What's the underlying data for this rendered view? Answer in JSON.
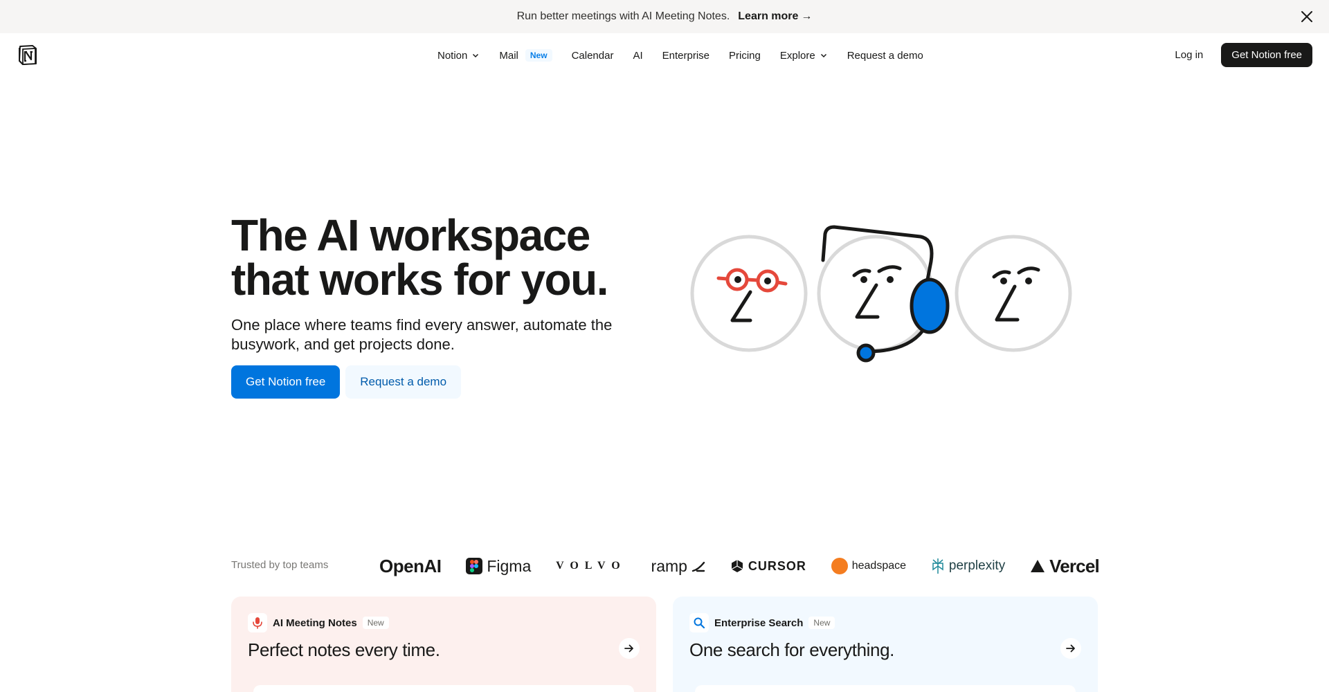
{
  "banner": {
    "message": "Run better meetings with AI Meeting Notes.",
    "link": "Learn more",
    "link_arrow": "→"
  },
  "nav": {
    "items": [
      {
        "label": "Notion",
        "dropdown": true
      },
      {
        "label": "Mail",
        "badge": "New"
      },
      {
        "label": "Calendar"
      },
      {
        "label": "AI"
      },
      {
        "label": "Enterprise"
      },
      {
        "label": "Pricing"
      },
      {
        "label": "Explore",
        "dropdown": true
      },
      {
        "label": "Request a demo"
      }
    ],
    "login": "Log in",
    "cta": "Get Notion free"
  },
  "hero": {
    "title_line1": "The AI workspace",
    "title_line2": "that works for you.",
    "subtitle": "One place where teams find every answer, automate the busywork, and get projects done.",
    "primary_cta": "Get Notion free",
    "secondary_cta": "Request a demo"
  },
  "trusted": {
    "label": "Trusted by top teams",
    "logos": [
      "OpenAI",
      "Figma",
      "VOLVO",
      "ramp",
      "CURSOR",
      "headspace",
      "perplexity",
      "Vercel"
    ]
  },
  "cards": [
    {
      "label": "AI Meeting Notes",
      "badge": "New",
      "title": "Perfect notes every time.",
      "icon": "microphone-icon"
    },
    {
      "label": "Enterprise Search",
      "badge": "New",
      "title": "One search for everything.",
      "icon": "search-icon"
    }
  ],
  "colors": {
    "primary": "#0075de",
    "dark": "#191918",
    "banner_bg": "#f6f5f4",
    "meeting_card_bg": "#fdf0ee",
    "search_card_bg": "#f2f9ff",
    "accent_red": "#e5483b"
  }
}
